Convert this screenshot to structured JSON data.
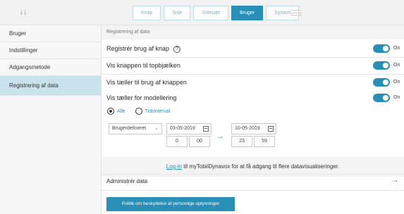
{
  "topbar": {
    "collapse_icon": "double-chevron-down-icon",
    "tabs": [
      {
        "label": "Knap",
        "active": false
      },
      {
        "label": "Side",
        "active": false
      },
      {
        "label": "Sidesæt",
        "active": false
      },
      {
        "label": "Bruger",
        "active": true
      },
      {
        "label": "System",
        "active": false
      }
    ],
    "menu_icon": "hamburger-icon"
  },
  "sidebar": {
    "items": [
      {
        "label": "Bruger",
        "active": false
      },
      {
        "label": "Indstillinger",
        "active": false
      },
      {
        "label": "Adgangsmetode",
        "active": false
      },
      {
        "label": "Registrering af data",
        "active": true
      }
    ]
  },
  "main": {
    "section_title": "Registrering af data",
    "settings": [
      {
        "label": "Registrér brug af knap",
        "toggle": "On",
        "has_help": true
      },
      {
        "label": "Vis knappen til topbjælken",
        "toggle": "On",
        "has_help": false
      },
      {
        "label": "Vis tæller til brug af knappen",
        "toggle": "On",
        "has_help": false
      },
      {
        "label": "Vis tæller for modellering",
        "toggle": "On",
        "has_help": false
      }
    ],
    "help_symbol": "?",
    "range": {
      "options": [
        "Alle",
        "Tidsinterval"
      ],
      "selected": "Alle",
      "preset": "Brugerdefineret",
      "from_date": "03-05-2019",
      "from_hour": "0",
      "from_minute": "00",
      "to_date": "10-05-2019",
      "to_hour": "23",
      "to_minute": "59"
    },
    "login": {
      "link": "Log-in",
      "text": " til myTobiiDynavox for at få adgang til flere datavisualiseringer."
    },
    "admin_label": "Administrér data",
    "privacy_button": "Politik om beskyttelse af personlige oplysninger"
  },
  "colors": {
    "accent": "#2a8fb6",
    "sidebar_active": "#c9e2ec"
  }
}
